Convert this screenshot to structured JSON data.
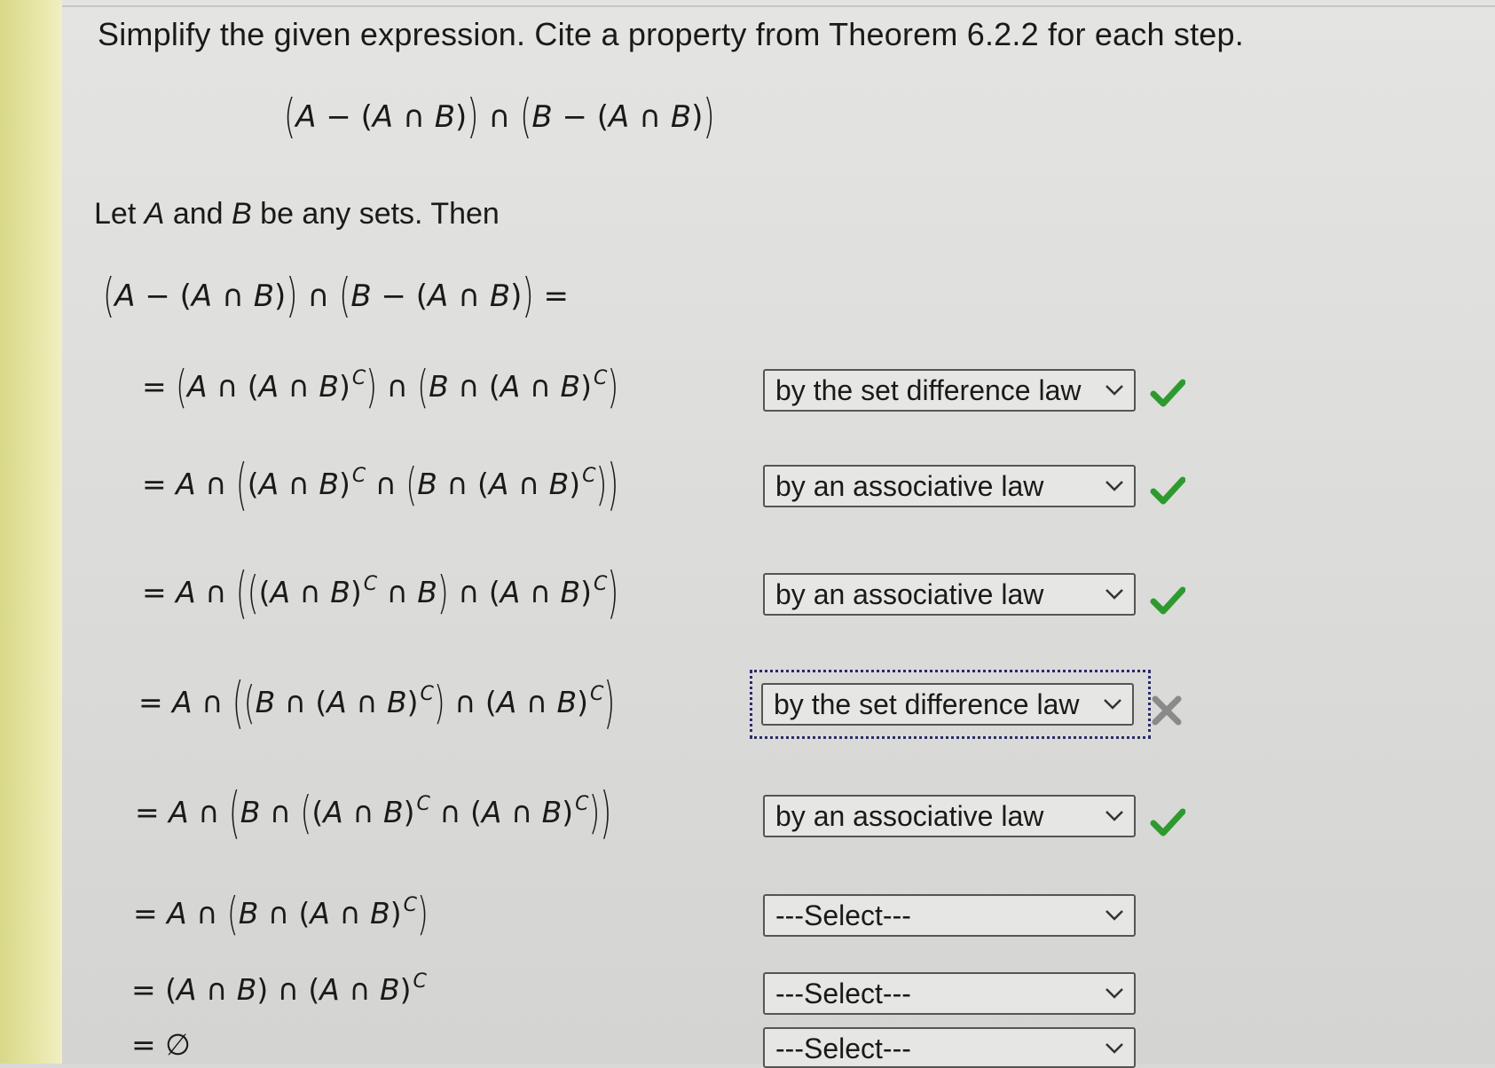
{
  "prompt": "Simplify the given expression. Cite a property from Theorem 6.2.2 for each step.",
  "display_expression": "(A − (A ∩ B)) ∩ (B − (A ∩ B))",
  "let_line": "Let A and B be any sets. Then",
  "lhs": "(A − (A ∩ B)) ∩ (B − (A ∩ B)) =",
  "steps": [
    {
      "expr": "= (A ∩ (A ∩ B)ᶜ) ∩ (B ∩ (A ∩ B)ᶜ)",
      "reason": "by the set difference law",
      "status": "correct"
    },
    {
      "expr": "= A ∩ ((A ∩ B)ᶜ ∩ (B ∩ (A ∩ B)ᶜ))",
      "reason": "by an associative law",
      "status": "correct"
    },
    {
      "expr": "= A ∩ (((A ∩ B)ᶜ ∩ B) ∩ (A ∩ B)ᶜ)",
      "reason": "by an associative law",
      "status": "correct"
    },
    {
      "expr": "= A ∩ ((B ∩ (A ∩ B)ᶜ) ∩ (A ∩ B)ᶜ)",
      "reason": "by the set difference law",
      "status": "incorrect"
    },
    {
      "expr": "= A ∩ (B ∩ ((A ∩ B)ᶜ ∩ (A ∩ B)ᶜ))",
      "reason": "by an associative law",
      "status": "correct"
    },
    {
      "expr": "= A ∩ (B ∩ (A ∩ B)ᶜ)",
      "reason": "---Select---",
      "status": "none"
    },
    {
      "expr": "= (A ∩ B) ∩ (A ∩ B)ᶜ",
      "reason": "---Select---",
      "status": "none"
    },
    {
      "expr": "= ∅",
      "reason": "---Select---",
      "status": "none"
    }
  ],
  "icons": {
    "dropdown": "chevron-down-icon",
    "correct": "green-checkmark-icon",
    "incorrect": "gray-x-icon"
  },
  "colors": {
    "check_green": "#2e9a2e",
    "x_gray": "#8a8a8a",
    "focus_ring": "#2a2a6a"
  }
}
